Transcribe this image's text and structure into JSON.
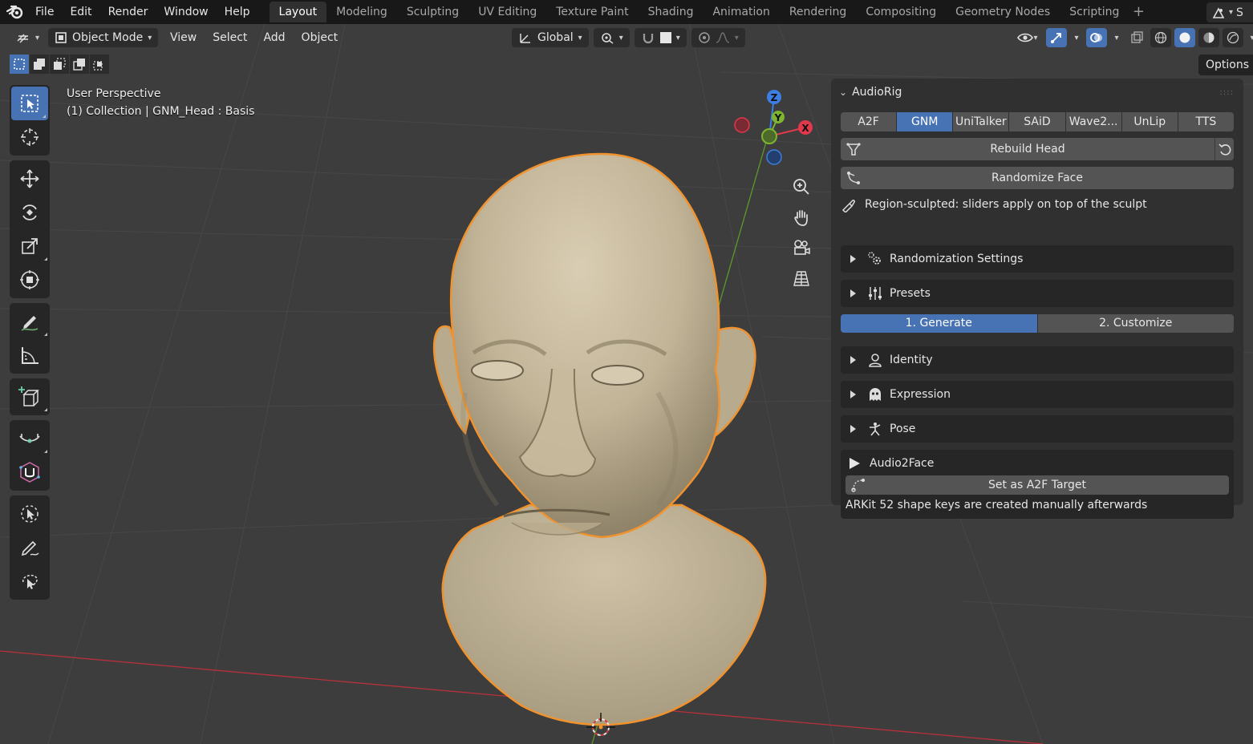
{
  "app_menu": [
    "File",
    "Edit",
    "Render",
    "Window",
    "Help"
  ],
  "workspaces": [
    "Layout",
    "Modeling",
    "Sculpting",
    "UV Editing",
    "Texture Paint",
    "Shading",
    "Animation",
    "Rendering",
    "Compositing",
    "Geometry Nodes",
    "Scripting"
  ],
  "active_workspace": "Layout",
  "scene_selector": "S",
  "viewport_header": {
    "mode": "Object Mode",
    "menus": [
      "View",
      "Select",
      "Add",
      "Object"
    ],
    "orientation": "Global"
  },
  "options_label": "Options",
  "viewport_info": {
    "view_name": "User Perspective",
    "collection": "(1) Collection | GNM_Head : Basis"
  },
  "gizmo_axes": {
    "x": "X",
    "y": "Y",
    "z": "Z"
  },
  "colors": {
    "accent": "#4772b3",
    "selection_outline": "#f0922e",
    "x_axis": "#e2384c",
    "y_axis": "#7db531",
    "z_axis": "#3d7ee2",
    "viewport_bg": "#3d3d3d"
  },
  "npanel": {
    "title": "AudioRig",
    "tabs": [
      "A2F",
      "GNM",
      "UniTalker",
      "SAiD",
      "Wave2...",
      "UnLip",
      "TTS"
    ],
    "active_tab": "GNM",
    "rebuild_label": "Rebuild Head",
    "randomize_label": "Randomize Face",
    "sculpt_note": "Region-sculpted: sliders apply on top of the sculpt",
    "randomization_settings": "Randomization Settings",
    "presets": "Presets",
    "steps": [
      "1. Generate",
      "2. Customize"
    ],
    "active_step": "1. Generate",
    "identity": "Identity",
    "expression": "Expression",
    "pose": "Pose",
    "a2f_title": "Audio2Face",
    "set_target_label": "Set as A2F Target",
    "arkit_note": "ARKit 52 shape keys are created manually afterwards"
  }
}
